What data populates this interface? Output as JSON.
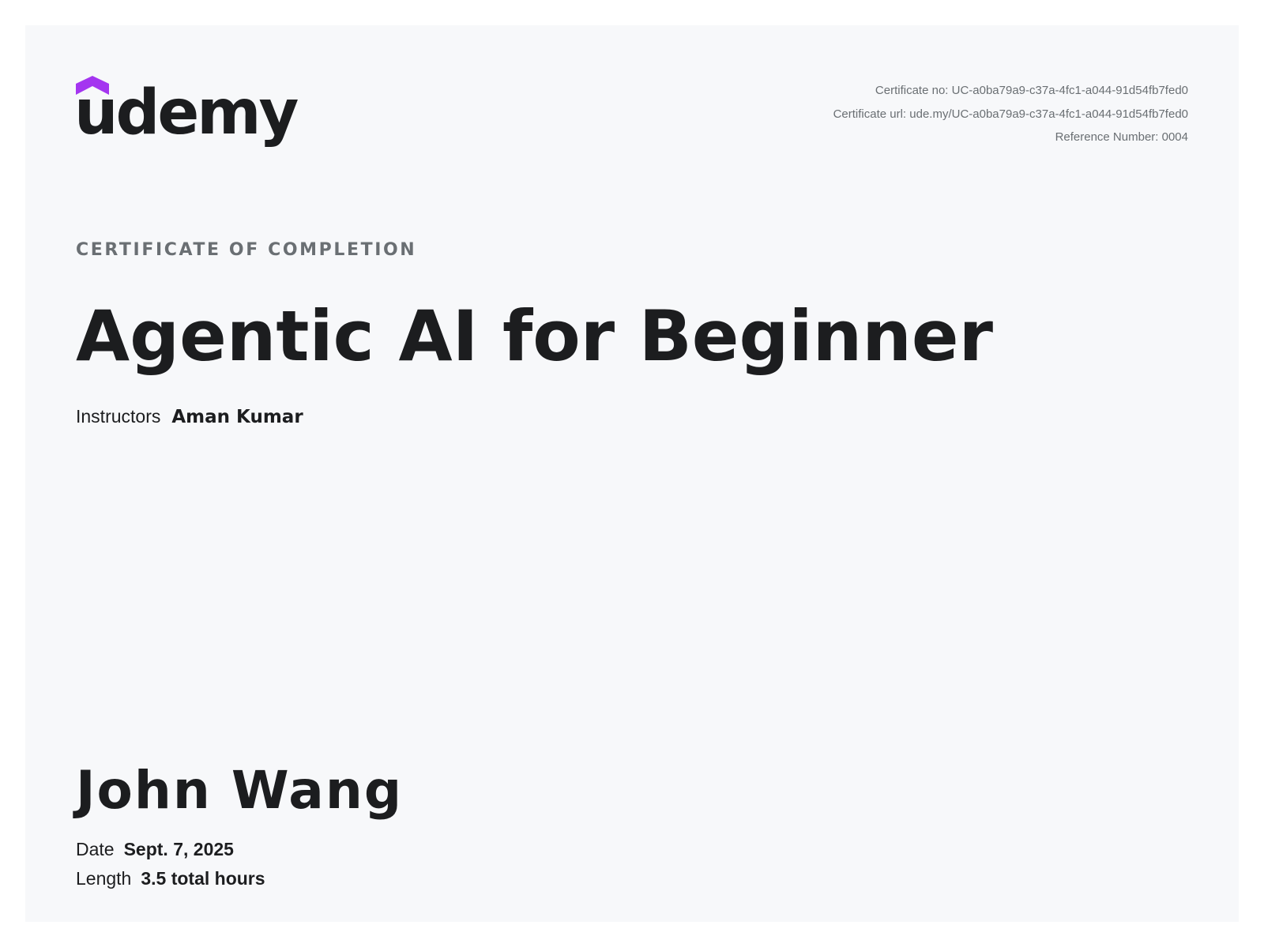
{
  "brand": {
    "logo_text": "udemy",
    "accent_color": "#a435f0"
  },
  "certificate_meta": {
    "number": "Certificate no: UC-a0ba79a9-c37a-4fc1-a044-91d54fb7fed0",
    "url": "Certificate url: ude.my/UC-a0ba79a9-c37a-4fc1-a044-91d54fb7fed0",
    "reference": "Reference Number: 0004"
  },
  "certificate_label": "CERTIFICATE OF COMPLETION",
  "course": {
    "title": "Agentic AI for Beginner",
    "instructors_label": "Instructors",
    "instructors": "Aman Kumar"
  },
  "recipient": {
    "name": "John Wang",
    "date_label": "Date",
    "date": "Sept. 7, 2025",
    "length_label": "Length",
    "length": "3.5 total hours"
  }
}
